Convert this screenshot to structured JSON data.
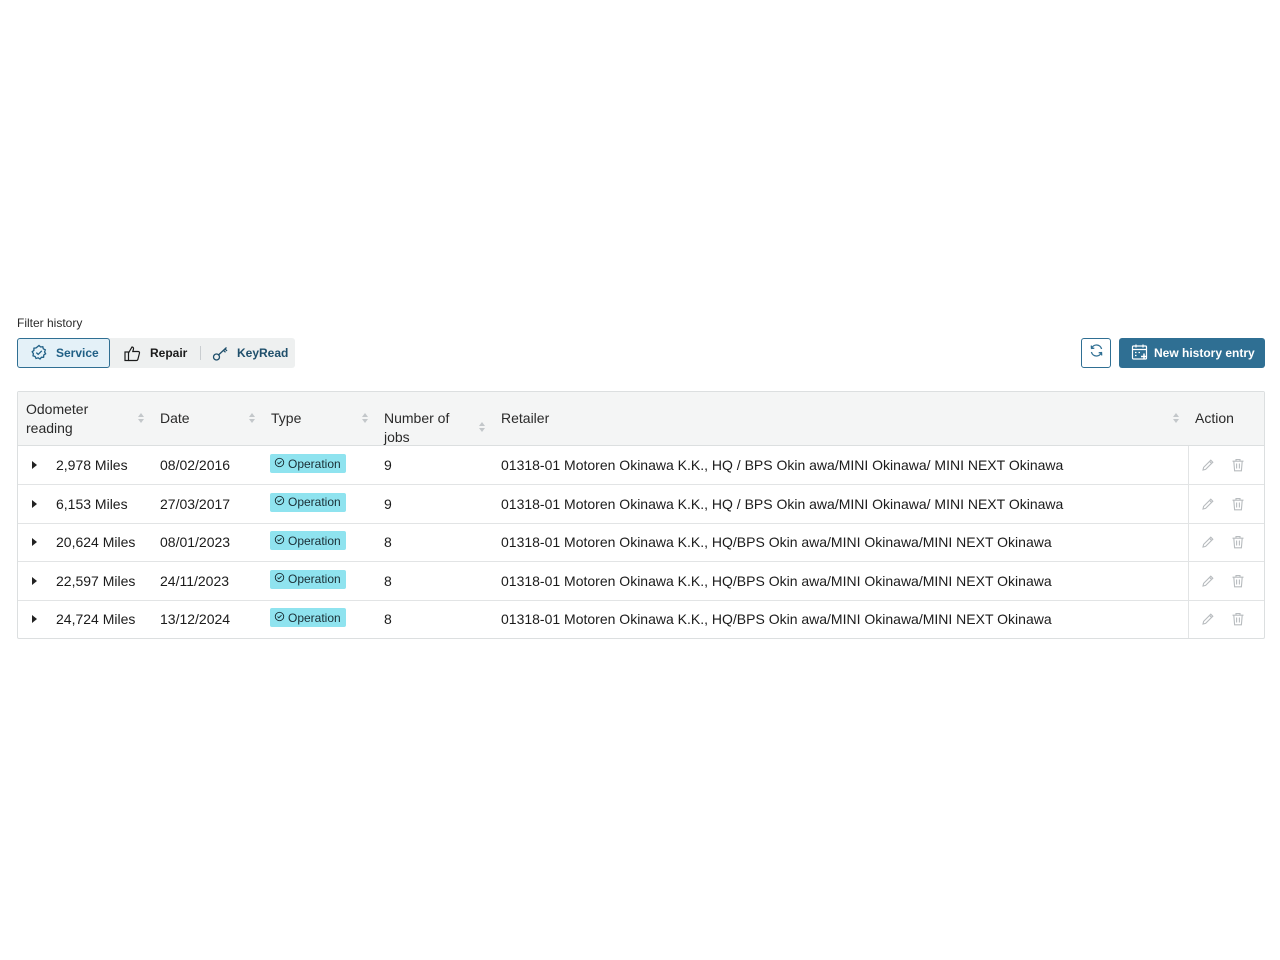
{
  "filter": {
    "label": "Filter history",
    "options": [
      {
        "label": "Service",
        "icon": "service-gear-check-icon",
        "active": true
      },
      {
        "label": "Repair",
        "icon": "thumbs-up-icon",
        "active": false
      },
      {
        "label": "KeyRead",
        "icon": "key-icon",
        "active": false
      }
    ]
  },
  "toolbar": {
    "refresh_icon": "refresh-icon",
    "new_entry_label": "New history entry",
    "new_entry_icon": "calendar-plus-icon"
  },
  "colors": {
    "primary": "#2f6f93",
    "badge": "#8fe3ef",
    "header_bg": "#f4f5f5"
  },
  "table": {
    "headers": {
      "odometer_line1": "Odometer",
      "odometer_line2": "reading",
      "date": "Date",
      "type": "Type",
      "jobs_line1": "Number of",
      "jobs_line2": "jobs",
      "retailer": "Retailer",
      "action": "Action"
    },
    "rows": [
      {
        "odometer": "2,978 Miles",
        "date": "08/02/2016",
        "type": "Operation",
        "jobs": "9",
        "retailer": "01318-01 Motoren Okinawa K.K., HQ / BPS Okin awa/MINI Okinawa/ MINI NEXT Okinawa"
      },
      {
        "odometer": "6,153 Miles",
        "date": "27/03/2017",
        "type": "Operation",
        "jobs": "9",
        "retailer": "01318-01 Motoren Okinawa K.K., HQ / BPS Okin awa/MINI Okinawa/ MINI NEXT Okinawa"
      },
      {
        "odometer": "20,624 Miles",
        "date": "08/01/2023",
        "type": "Operation",
        "jobs": "8",
        "retailer": "01318-01 Motoren Okinawa K.K., HQ/BPS Okin awa/MINI Okinawa/MINI NEXT Okinawa"
      },
      {
        "odometer": "22,597 Miles",
        "date": "24/11/2023",
        "type": "Operation",
        "jobs": "8",
        "retailer": "01318-01 Motoren Okinawa K.K., HQ/BPS Okin awa/MINI Okinawa/MINI NEXT Okinawa"
      },
      {
        "odometer": "24,724 Miles",
        "date": "13/12/2024",
        "type": "Operation",
        "jobs": "8",
        "retailer": "01318-01 Motoren Okinawa K.K., HQ/BPS Okin awa/MINI Okinawa/MINI NEXT Okinawa"
      }
    ]
  }
}
